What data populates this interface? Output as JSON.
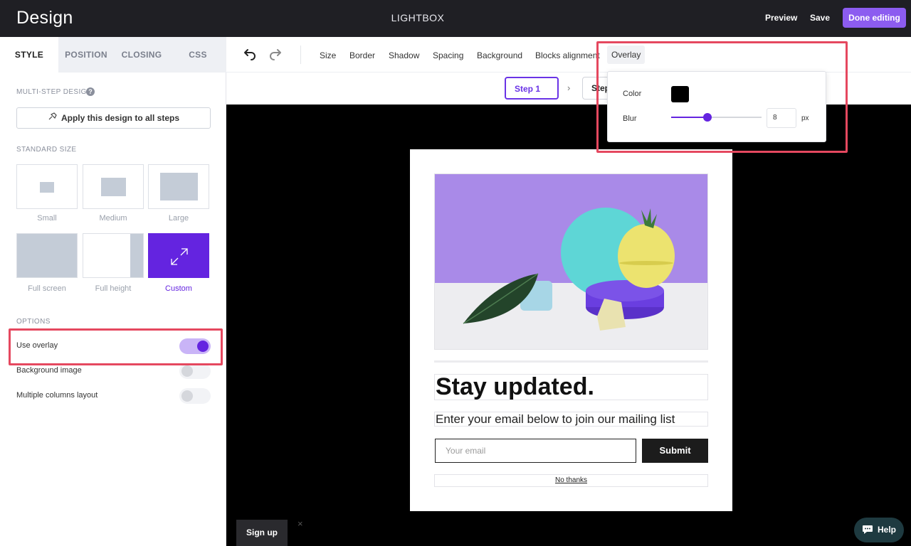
{
  "topbar": {
    "title": "Design",
    "center_title": "LIGHTBOX",
    "preview": "Preview",
    "save": "Save",
    "done": "Done editing"
  },
  "sidebar": {
    "tabs": [
      "STYLE",
      "POSITION",
      "CLOSING",
      "CSS"
    ],
    "active_tab": "STYLE",
    "multistep_label": "MULTI-STEP DESIGN",
    "help_glyph": "?",
    "apply_label": "Apply this design to all steps",
    "standard_size_label": "STANDARD SIZE",
    "sizes": [
      {
        "label": "Small"
      },
      {
        "label": "Medium"
      },
      {
        "label": "Large"
      },
      {
        "label": "Full screen"
      },
      {
        "label": "Full height"
      },
      {
        "label": "Custom"
      }
    ],
    "selected_size": "Custom",
    "options_label": "OPTIONS",
    "options": [
      {
        "label": "Use overlay",
        "on": true
      },
      {
        "label": "Background image",
        "on": false
      },
      {
        "label": "Multiple columns layout",
        "on": false
      }
    ]
  },
  "toolbar": {
    "items": [
      "Size",
      "Border",
      "Shadow",
      "Spacing",
      "Background",
      "Blocks alignment",
      "Overlay"
    ],
    "active_item": "Overlay",
    "icons": [
      "undo-icon",
      "redo-icon"
    ]
  },
  "steps": {
    "active": "Step 1",
    "next": "Step"
  },
  "overlay_popover": {
    "color_label": "Color",
    "color_value": "#000000",
    "blur_label": "Blur",
    "blur_value": "8",
    "blur_unit": "px",
    "blur_fraction": 0.4
  },
  "modal": {
    "title": "Stay updated.",
    "subtitle": "Enter your email below to join our mailing list",
    "email_placeholder": "Your email",
    "submit": "Submit",
    "no_thanks": "No thanks"
  },
  "canvas": {
    "signup_tab": "Sign up",
    "close_glyph": "×",
    "help": "Help"
  },
  "colors": {
    "accent": "#6424e0",
    "done_button": "#8c5cf0",
    "highlight": "#e5485f",
    "topbar": "#1f1f24"
  }
}
